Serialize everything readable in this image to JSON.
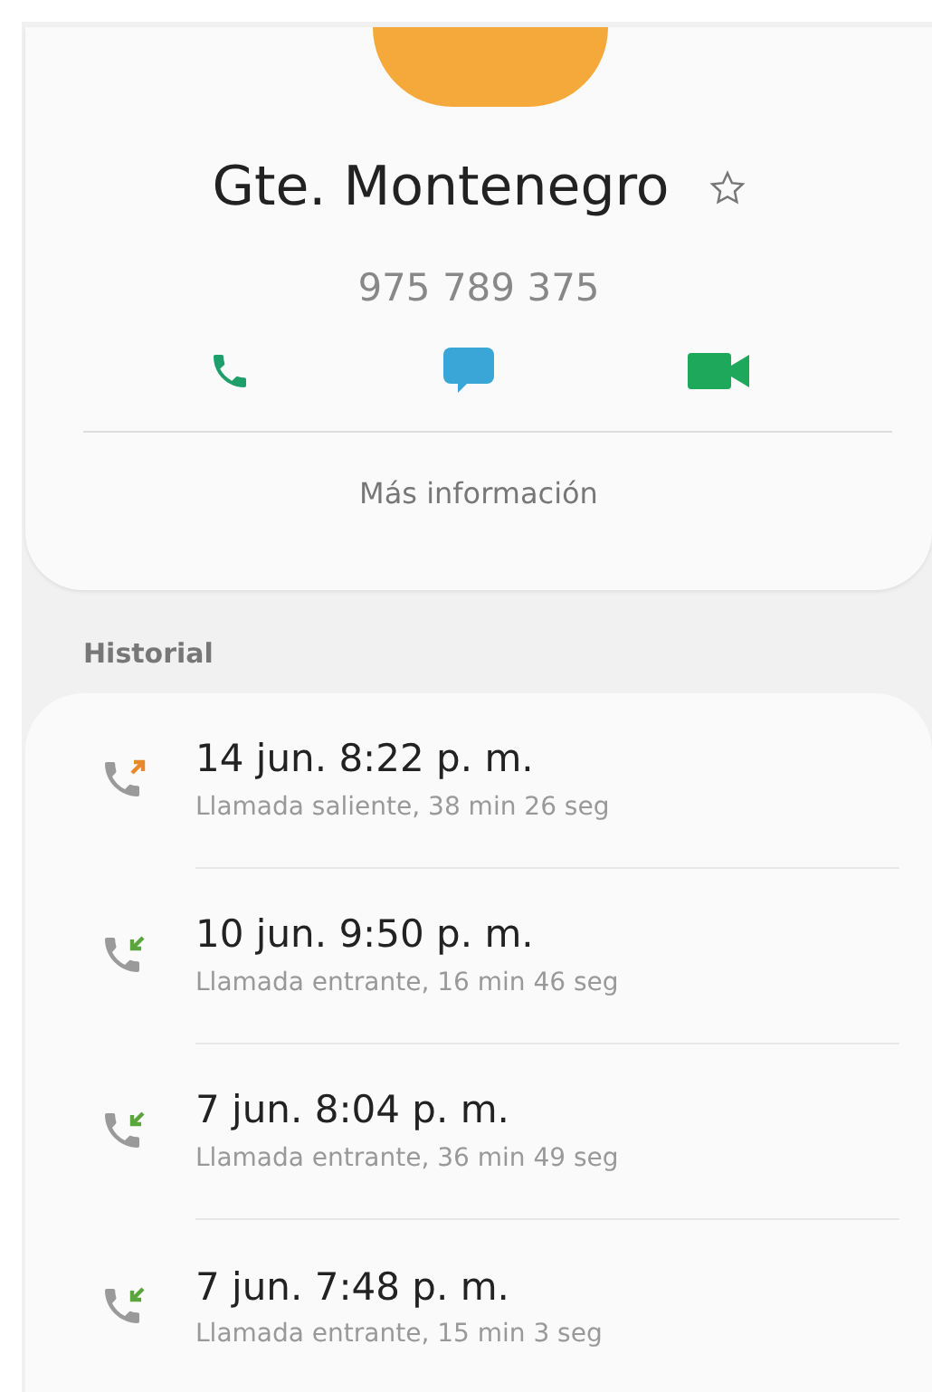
{
  "contact": {
    "name": "Gte. Montenegro",
    "favorite": false,
    "phone": "975 789 375",
    "more_info": "Más información"
  },
  "history": {
    "title": "Historial",
    "calls": [
      {
        "kind": "outgoing",
        "time": "14 jun. 8:22 p. m.",
        "detail": "Llamada saliente, 38 min 26 seg"
      },
      {
        "kind": "incoming",
        "time": "10 jun. 9:50 p. m.",
        "detail": "Llamada entrante, 16 min 46 seg"
      },
      {
        "kind": "incoming",
        "time": "7 jun. 8:04 p. m.",
        "detail": "Llamada entrante, 36 min 49 seg"
      },
      {
        "kind": "incoming",
        "time": "7 jun. 7:48 p. m.",
        "detail": "Llamada entrante, 15 min 3 seg"
      }
    ]
  }
}
